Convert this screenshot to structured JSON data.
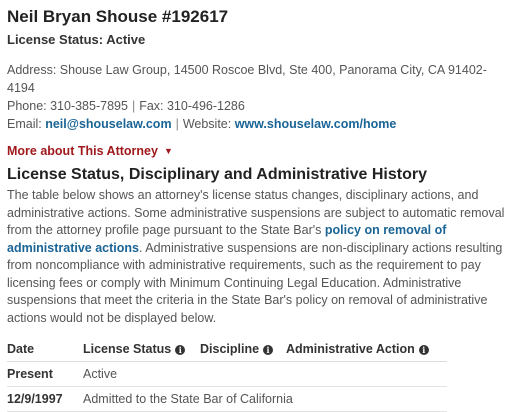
{
  "attorney": {
    "name": "Neil Bryan Shouse #192617",
    "license_status_label": "License Status: Active"
  },
  "contact": {
    "address_line1": "Address: Shouse Law Group, 14500 Roscoe Blvd, Ste 400, Panorama City, CA 91402-",
    "address_line2": "4194",
    "phone": "Phone: 310-385-7895",
    "fax": "Fax: 310-496-1286",
    "email_label": "Email:",
    "email": "neil@shouselaw.com",
    "website_label": "Website:",
    "website": "www.shouselaw.com/home"
  },
  "more_link": "More about This Attorney",
  "history": {
    "heading": "License Status, Disciplinary and Administrative History",
    "para_part1": "The table below shows an attorney's license status changes, disciplinary actions, and administrative actions. Some administrative suspensions are subject to automatic removal from the attorney profile page pursuant to the State Bar's ",
    "policy_link": "policy on removal of administrative actions",
    "para_part2": ". Administrative suspensions are non-disciplinary actions resulting from noncompliance with administrative requirements, such as the requirement to pay licensing fees or comply with Minimum Continuing Legal Education. Administrative suspensions that meet the criteria in the State Bar's policy on removal of administrative actions would not be displayed below."
  },
  "table": {
    "headers": [
      "Date",
      "License Status",
      "Discipline",
      "Administrative Action"
    ],
    "rows": [
      {
        "date": "Present",
        "license_status": "Active",
        "discipline": "",
        "admin_action": ""
      },
      {
        "date": "12/9/1997",
        "license_status": "Admitted to the State Bar of California",
        "discipline": "",
        "admin_action": ""
      }
    ]
  },
  "icons": {
    "info": "info-circle-icon",
    "caret": "caret-down-icon"
  },
  "colors": {
    "link": "#1a6496",
    "more_link": "#a0191c",
    "text": "#555555"
  }
}
